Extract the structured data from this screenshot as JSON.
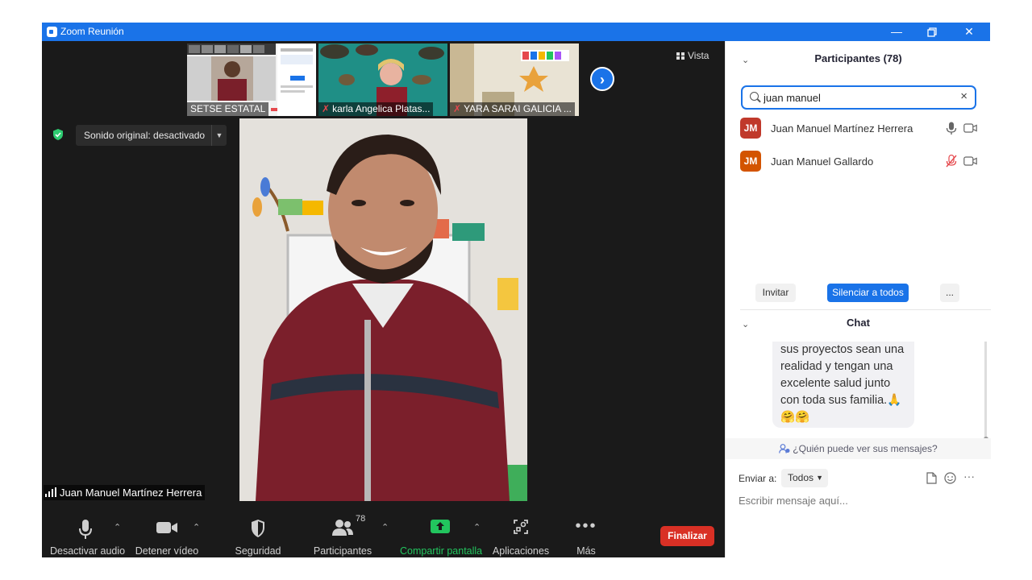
{
  "window": {
    "title": "Zoom Reunión"
  },
  "thumbnails": [
    {
      "name": "SETSE ESTATAL",
      "muted": false
    },
    {
      "name": "karla Angelica  Platas...",
      "muted": true
    },
    {
      "name": "YARA SARAI GALICIA ...",
      "muted": true
    }
  ],
  "view_label": "Vista",
  "sound_original": "Sonido original: desactivado",
  "active_speaker": "Juan Manuel Martínez Herrera",
  "toolbar": {
    "audio": "Desactivar audio",
    "video": "Detener vídeo",
    "security": "Seguridad",
    "participants": "Participantes",
    "participants_count": "78",
    "share": "Compartir pantalla",
    "apps": "Aplicaciones",
    "more": "Más",
    "end": "Finalizar"
  },
  "participants_panel": {
    "title": "Participantes (78)",
    "search_value": "juan manuel",
    "list": [
      {
        "initials": "JM",
        "name": "Juan Manuel Martínez Herrera",
        "color": "#c0392b",
        "mic": "on"
      },
      {
        "initials": "JM",
        "name": "Juan Manuel Gallardo",
        "color": "#d35400",
        "mic": "muted"
      }
    ],
    "invite": "Invitar",
    "mute_all": "Silenciar a todos",
    "more": "..."
  },
  "chat": {
    "title": "Chat",
    "message": "sus proyectos sean una realidad y tengan una excelente salud junto con toda sus familia.🙏🤗🤗",
    "who_can_see": "¿Quién puede ver sus mensajes?",
    "send_to_label": "Enviar a:",
    "send_to_value": "Todos",
    "placeholder": "Escribir mensaje aquí..."
  },
  "colors": {
    "accent": "#1a73e8",
    "end": "#d93025",
    "share": "#22c55e"
  }
}
